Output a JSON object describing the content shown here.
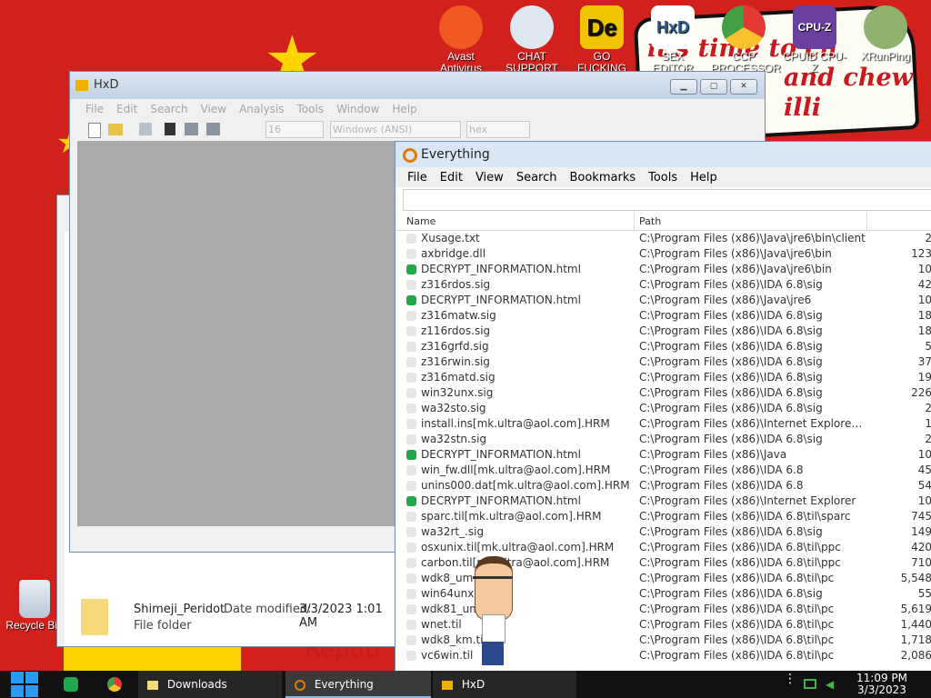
{
  "desktop": {
    "banner_text": [
      "it's time to ch",
      "and chew",
      "illi"
    ],
    "bottom_text": "Repub",
    "icons": [
      {
        "label": "Avast Antivirus",
        "color": "#f05a22"
      },
      {
        "label": "CHAT SUPPORT",
        "color": "#dfe8f0"
      },
      {
        "label": "GO FUCKING DIE WHORE",
        "color": "#f0c400"
      },
      {
        "label": "SEX EDITOR",
        "color": "#ffffff"
      },
      {
        "label": "CCP PROCESSOR",
        "color": "#4caf50"
      },
      {
        "label": "CPUID CPU-Z",
        "color": "#6a3fa0"
      },
      {
        "label": "XRunPing",
        "color": "#8fb36e"
      }
    ],
    "recycle_bin": "Recycle Bin"
  },
  "hxd": {
    "title": "HxD",
    "menu": [
      "File",
      "Edit",
      "Search",
      "View",
      "Analysis",
      "Tools",
      "Window",
      "Help"
    ],
    "toolbar": {
      "bytes_per_row": "16",
      "charset": "Windows (ANSI)",
      "offset_base": "hex"
    }
  },
  "explorer": {
    "folder_name": "Shimeji_Peridot",
    "modified_label": "Date modified:",
    "modified_value": "3/3/2023 1:01 AM",
    "type": "File folder"
  },
  "everything": {
    "title": "Everything",
    "menu": [
      "File",
      "Edit",
      "View",
      "Search",
      "Bookmarks",
      "Tools",
      "Help"
    ],
    "search_value": "",
    "columns": {
      "name": "Name",
      "path": "Path"
    },
    "rows": [
      {
        "name": "Xusage.txt",
        "path": "C:\\Program Files (x86)\\Java\\jre6\\bin\\client",
        "size": "2",
        "icon": "file"
      },
      {
        "name": "axbridge.dll",
        "path": "C:\\Program Files (x86)\\Java\\jre6\\bin",
        "size": "123",
        "icon": "file"
      },
      {
        "name": "DECRYPT_INFORMATION.html",
        "path": "C:\\Program Files (x86)\\Java\\jre6\\bin",
        "size": "10",
        "icon": "html"
      },
      {
        "name": "z316rdos.sig",
        "path": "C:\\Program Files (x86)\\IDA 6.8\\sig",
        "size": "42",
        "icon": "file"
      },
      {
        "name": "DECRYPT_INFORMATION.html",
        "path": "C:\\Program Files (x86)\\Java\\jre6",
        "size": "10",
        "icon": "html"
      },
      {
        "name": "z316matw.sig",
        "path": "C:\\Program Files (x86)\\IDA 6.8\\sig",
        "size": "18",
        "icon": "file"
      },
      {
        "name": "z116rdos.sig",
        "path": "C:\\Program Files (x86)\\IDA 6.8\\sig",
        "size": "18",
        "icon": "file"
      },
      {
        "name": "z316grfd.sig",
        "path": "C:\\Program Files (x86)\\IDA 6.8\\sig",
        "size": "5",
        "icon": "file"
      },
      {
        "name": "z316rwin.sig",
        "path": "C:\\Program Files (x86)\\IDA 6.8\\sig",
        "size": "37",
        "icon": "file"
      },
      {
        "name": "z316matd.sig",
        "path": "C:\\Program Files (x86)\\IDA 6.8\\sig",
        "size": "19",
        "icon": "file"
      },
      {
        "name": "win32unx.sig",
        "path": "C:\\Program Files (x86)\\IDA 6.8\\sig",
        "size": "226",
        "icon": "file"
      },
      {
        "name": "wa32sto.sig",
        "path": "C:\\Program Files (x86)\\IDA 6.8\\sig",
        "size": "2",
        "icon": "file"
      },
      {
        "name": "install.ins[mk.ultra@aol.com].HRM",
        "path": "C:\\Program Files (x86)\\Internet Explorer\\S...",
        "size": "1",
        "icon": "file"
      },
      {
        "name": "wa32stn.sig",
        "path": "C:\\Program Files (x86)\\IDA 6.8\\sig",
        "size": "2",
        "icon": "file"
      },
      {
        "name": "DECRYPT_INFORMATION.html",
        "path": "C:\\Program Files (x86)\\Java",
        "size": "10",
        "icon": "html"
      },
      {
        "name": "win_fw.dll[mk.ultra@aol.com].HRM",
        "path": "C:\\Program Files (x86)\\IDA 6.8",
        "size": "45",
        "icon": "file"
      },
      {
        "name": "unins000.dat[mk.ultra@aol.com].HRM",
        "path": "C:\\Program Files (x86)\\IDA 6.8",
        "size": "54",
        "icon": "file"
      },
      {
        "name": "DECRYPT_INFORMATION.html",
        "path": "C:\\Program Files (x86)\\Internet Explorer",
        "size": "10",
        "icon": "html"
      },
      {
        "name": "sparc.til[mk.ultra@aol.com].HRM",
        "path": "C:\\Program Files (x86)\\IDA 6.8\\til\\sparc",
        "size": "745",
        "icon": "file"
      },
      {
        "name": "wa32rt_.sig",
        "path": "C:\\Program Files (x86)\\IDA 6.8\\sig",
        "size": "149",
        "icon": "file"
      },
      {
        "name": "osxunix.til[mk.ultra@aol.com].HRM",
        "path": "C:\\Program Files (x86)\\IDA 6.8\\til\\ppc",
        "size": "420",
        "icon": "file"
      },
      {
        "name": "carbon.til[mk.ultra@aol.com].HRM",
        "path": "C:\\Program Files (x86)\\IDA 6.8\\til\\ppc",
        "size": "710",
        "icon": "file"
      },
      {
        "name": "wdk8_um",
        "path": "C:\\Program Files (x86)\\IDA 6.8\\til\\pc",
        "size": "5,548",
        "icon": "file"
      },
      {
        "name": "win64unx.s",
        "path": "C:\\Program Files (x86)\\IDA 6.8\\sig",
        "size": "55",
        "icon": "file"
      },
      {
        "name": "wdk81_um",
        "path": "C:\\Program Files (x86)\\IDA 6.8\\til\\pc",
        "size": "5,619",
        "icon": "file"
      },
      {
        "name": "wnet.til",
        "path": "C:\\Program Files (x86)\\IDA 6.8\\til\\pc",
        "size": "1,440",
        "icon": "file"
      },
      {
        "name": "wdk8_km.til",
        "path": "C:\\Program Files (x86)\\IDA 6.8\\til\\pc",
        "size": "1,718",
        "icon": "file"
      },
      {
        "name": "vc6win.til",
        "path": "C:\\Program Files (x86)\\IDA 6.8\\til\\pc",
        "size": "2,086",
        "icon": "file"
      }
    ]
  },
  "taskbar": {
    "items": [
      "Downloads",
      "Everything",
      "HxD"
    ],
    "time": "11:09 PM",
    "date": "3/3/2023"
  },
  "colors": {
    "desktop_red": "#d2211c",
    "flag_yellow": "#ffd400",
    "html_icon": "#22a84a",
    "accent": "#8cb4e8"
  }
}
